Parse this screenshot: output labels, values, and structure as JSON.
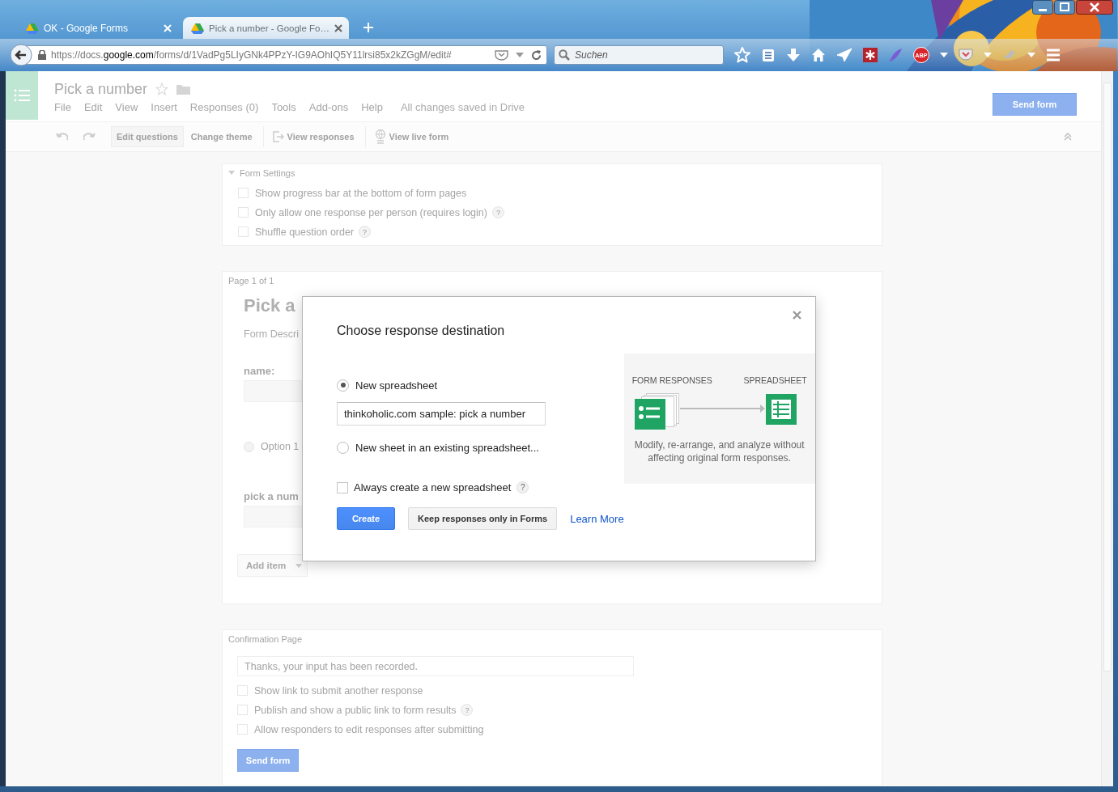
{
  "browser": {
    "tabs": [
      {
        "title": "OK - Google Forms",
        "selected": false
      },
      {
        "title": "Pick a number - Google Fo…",
        "selected": true
      }
    ],
    "url": "https://docs.**google.com**/forms/d/1VadPg5LIyGNk4PPzY-IG9AOhIQ5Y11lrsi85x2kZGgM/edit#",
    "search": {
      "placeholder": "Suchen"
    },
    "adblock_badge": "ABP"
  },
  "docs": {
    "title": "Pick a number",
    "menu": [
      "File",
      "Edit",
      "View",
      "Insert",
      "Responses (0)",
      "Tools",
      "Add-ons",
      "Help"
    ],
    "save_status": "All changes saved in Drive",
    "send_button": "Send form",
    "toolbar": [
      {
        "label": "Edit questions",
        "selected": true
      },
      {
        "label": "Change theme",
        "selected": false
      },
      {
        "label": "View responses",
        "selected": false
      },
      {
        "label": "View live form",
        "selected": false
      }
    ]
  },
  "form_settings": {
    "title": "Form Settings",
    "expanded": true,
    "options": [
      {
        "label": "Show progress bar at the bottom of form pages",
        "checked": false
      },
      {
        "label": "Only allow one response per person (requires login)",
        "checked": false,
        "help": "?"
      },
      {
        "label": "Shuffle question order",
        "checked": false,
        "help": "?"
      }
    ]
  },
  "page": {
    "label": "Page 1 of 1",
    "title": "Pick a",
    "description_placeholder": "Form Descri",
    "questions": [
      {
        "kind": "text",
        "title": "name:"
      },
      {
        "kind": "choice",
        "options": [
          {
            "label": "Option 1",
            "selected": false
          }
        ]
      },
      {
        "kind": "text",
        "title": "pick a num"
      }
    ],
    "add_item": "Add item"
  },
  "confirmation": {
    "label": "Confirmation Page",
    "message": "Thanks, your input has been recorded.",
    "options": [
      {
        "label": "Show link to submit another response",
        "checked": false
      },
      {
        "label": "Publish and show a public link to form results",
        "checked": false,
        "help": "?"
      },
      {
        "label": "Allow responders to edit responses after submitting",
        "checked": false
      }
    ],
    "send_button": "Send form"
  },
  "dialog": {
    "title": "Choose response destination",
    "options": [
      {
        "label": "New spreadsheet",
        "selected": true,
        "field": {
          "value": "thinkoholic.com sample: pick a number"
        }
      },
      {
        "label": "New sheet in an existing spreadsheet...",
        "selected": false
      }
    ],
    "always_new": {
      "label": "Always create a new spreadsheet",
      "checked": false,
      "help": "?"
    },
    "buttons": [
      {
        "label": "Create",
        "kind": "primary"
      },
      {
        "label": "Keep responses only in Forms",
        "kind": "secondary"
      }
    ],
    "link": "Learn More",
    "illustration": {
      "from_label": "FORM RESPONSES",
      "to_label": "SPREADSHEET",
      "caption": "Modify, re-arrange, and analyze without affecting original form responses."
    }
  }
}
